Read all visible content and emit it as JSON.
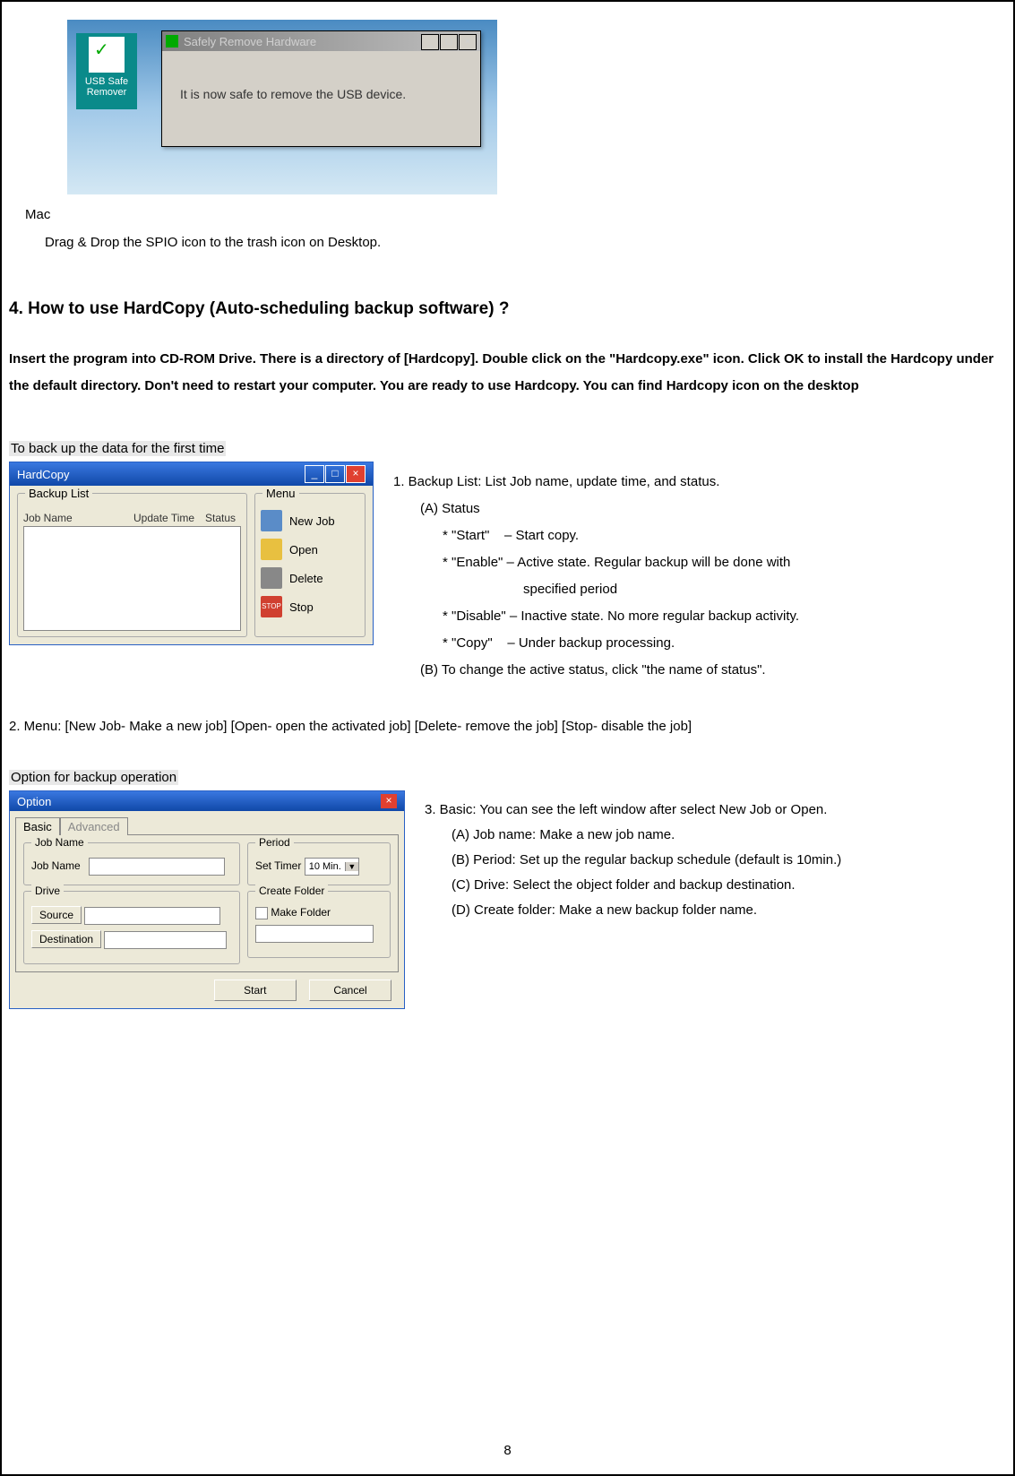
{
  "shot1": {
    "title": "Safely Remove Hardware",
    "body": "It is now safe to remove the USB device.",
    "usb_line1": "USB Safe",
    "usb_line2": "Remover",
    "min": "_",
    "max": "□",
    "close": "×"
  },
  "mac": "Mac",
  "drag": "Drag & Drop the SPIO icon to the trash icon on Desktop.",
  "sec4": "4. How to use HardCopy (Auto-scheduling backup software) ?",
  "para1": "Insert the program into CD-ROM Drive. There is a directory of [Hardcopy]. Double click on the \"Hardcopy.exe\" icon. Click OK to install the Hardcopy under the default directory. Don't need to restart your computer. You are ready to use Hardcopy. You can find Hardcopy icon on the desktop",
  "hl1": "To back up the data for the first time",
  "hc": {
    "title": "HardCopy",
    "backup": "Backup List",
    "c1": "Job Name",
    "c2": "Update Time",
    "c3": "Status",
    "menu": "Menu",
    "m1": "New Job",
    "m2": "Open",
    "m3": "Delete",
    "m4": "Stop",
    "stop": "STOP"
  },
  "d1": {
    "l1": "1. Backup List: List Job name, update time, and status.",
    "l2": "(A) Status",
    "l3": "* \"Start\"    – Start copy.",
    "l4": "* \"Enable\" – Active state. Regular backup will be done with",
    "l5": "specified period",
    "l6": "* \"Disable\" – Inactive state. No more regular backup activity.",
    "l7": "* \"Copy\"    – Under backup processing.",
    "l8": "(B) To change the active status, click \"the name of status\"."
  },
  "menuline": "2. Menu: [New Job- Make a new job] [Open- open the activated job] [Delete- remove the job] [Stop- disable the job]",
  "hl2": "Option for backup operation",
  "opt": {
    "title": "Option",
    "close": "×",
    "tab1": "Basic",
    "tab2": "Advanced",
    "g_jobname": "Job Name",
    "jobname": "Job Name",
    "g_period": "Period",
    "settimer": "Set Timer",
    "tenmin": "10 Min.",
    "g_drive": "Drive",
    "source": "Source",
    "destination": "Destination",
    "g_create": "Create Folder",
    "makefolder": "Make Folder",
    "start": "Start",
    "cancel": "Cancel",
    "arrow": "▼"
  },
  "d2": {
    "l1": "3. Basic: You can see the left window after select New Job or Open.",
    "l2": "(A) Job name: Make a new job name.",
    "l3": "(B) Period: Set up the regular backup schedule (default is 10min.)",
    "l4": "(C) Drive: Select the object folder and backup destination.",
    "l5": "(D) Create folder: Make a new backup folder name."
  },
  "pagenum": "8"
}
